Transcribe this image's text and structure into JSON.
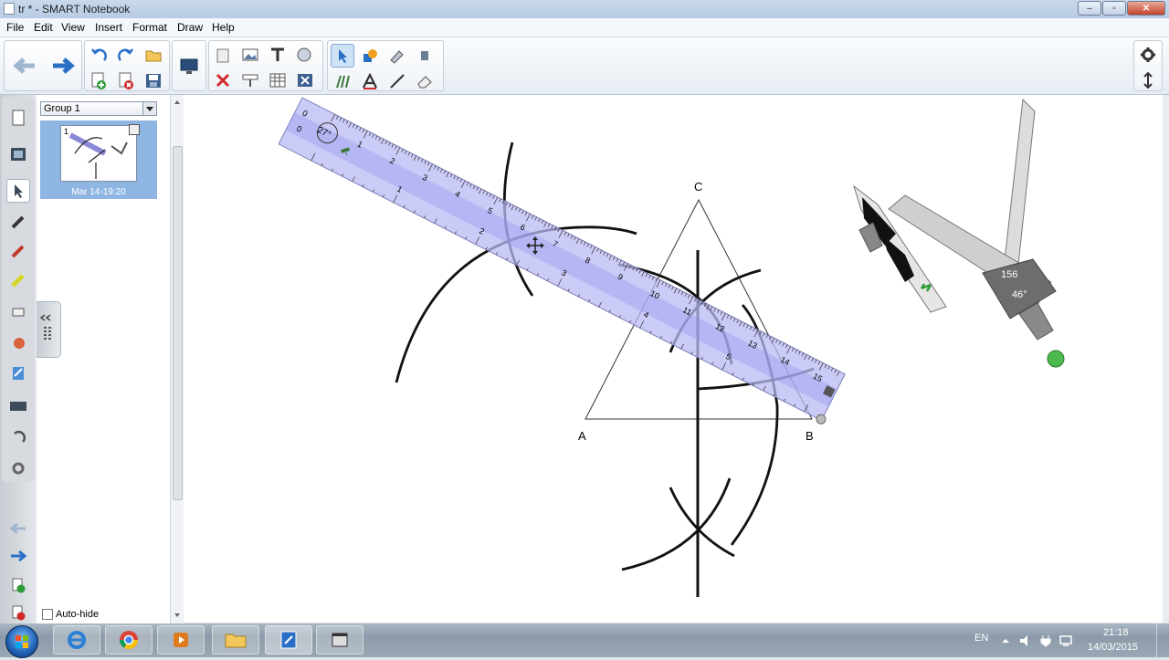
{
  "window": {
    "title": "tr * - SMART Notebook"
  },
  "menu": [
    "File",
    "Edit",
    "View",
    "Insert",
    "Format",
    "Draw",
    "Help"
  ],
  "sorter": {
    "group_label": "Group 1",
    "page_number": "1",
    "page_timestamp": "Mar 14-19:20",
    "autohide_label": "Auto-hide"
  },
  "canvas": {
    "labels": {
      "a": "A",
      "b": "B",
      "c": "C"
    },
    "ruler": {
      "angle_label": "27°",
      "zero_top": "0",
      "zero_left": "0",
      "cm_labels": [
        "1",
        "2",
        "3",
        "4",
        "5",
        "6",
        "7",
        "8",
        "9",
        "10",
        "11",
        "12",
        "13",
        "14",
        "15"
      ],
      "inch_labels": [
        "1",
        "2",
        "3",
        "4",
        "5"
      ]
    },
    "compass": {
      "radius_label": "156",
      "angle_label": "46°"
    }
  },
  "taskbar": {
    "language": "EN",
    "time": "21:18",
    "date": "14/03/2015"
  }
}
